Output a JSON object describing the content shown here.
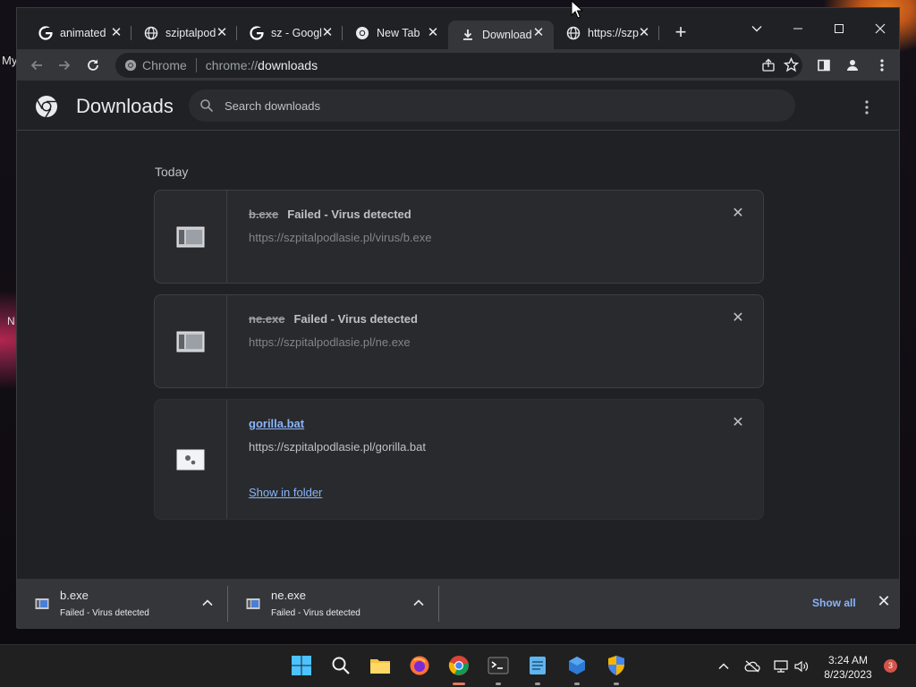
{
  "desktop": {
    "corner_text": "My",
    "side_letter": "N"
  },
  "tabs": [
    {
      "title": "animated",
      "icon": "google-icon"
    },
    {
      "title": "sziptalpod",
      "icon": "globe-icon"
    },
    {
      "title": "sz - Googl",
      "icon": "google-icon"
    },
    {
      "title": "New Tab",
      "icon": "chrome-icon"
    },
    {
      "title": "Download",
      "icon": "download-icon",
      "active": true
    },
    {
      "title": "https://szp",
      "icon": "globe-icon"
    }
  ],
  "omnibox": {
    "site_name": "Chrome",
    "url_scheme": "chrome://",
    "url_path": "downloads"
  },
  "page": {
    "title": "Downloads",
    "search_placeholder": "Search downloads",
    "section_label": "Today"
  },
  "downloads": [
    {
      "filename": "b.exe",
      "status": "Failed - Virus detected",
      "url": "https://szpitalpodlasie.pl/virus/b.exe"
    },
    {
      "filename": "ne.exe",
      "status": "Failed - Virus detected",
      "url": "https://szpitalpodlasie.pl/ne.exe"
    },
    {
      "filename": "gorilla.bat",
      "url": "https://szpitalpodlasie.pl/gorilla.bat",
      "action": "Show in folder"
    }
  ],
  "shelf": {
    "items": [
      {
        "name": "b.exe",
        "status": "Failed - Virus detected"
      },
      {
        "name": "ne.exe",
        "status": "Failed - Virus detected"
      }
    ],
    "show_all": "Show all"
  },
  "taskbar": {
    "time": "3:24 AM",
    "date": "8/23/2023",
    "notification_count": "3"
  },
  "colors": {
    "accent": "#8ab4f8",
    "page_bg": "#202124",
    "card_bg": "#292a2d",
    "toolbar_bg": "#35363a"
  }
}
